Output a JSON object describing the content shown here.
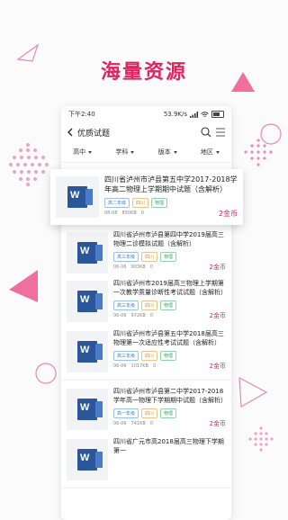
{
  "headline": "海量资源",
  "status": {
    "time": "下午2:40",
    "speed": "53.9K/s"
  },
  "nav": {
    "title": "优质试题"
  },
  "filters": [
    "高中",
    "学科",
    "版本",
    "地区"
  ],
  "featured": {
    "title": "四川省泸州市泸县第五中学2017-2018学年高二物理上学期期中试题（含解析）",
    "tags": [
      "高二年级",
      "四川",
      "物理"
    ],
    "date": "08-08",
    "size": "850KB",
    "downloads": "0",
    "price": "2金币"
  },
  "items": [
    {
      "title": "四川省泸州市泸县第四中学2019届高三物理二诊模拟试题（含解析）",
      "tags": [
        "高三年级",
        "四川",
        "物理"
      ],
      "date": "06-06",
      "size": "903KB",
      "downloads": "0",
      "price": "2金币"
    },
    {
      "title": "四川省泸州市2019届高三物理上学期第一次教学质量诊断性考试试题（含解析）",
      "tags": [
        "高三年级",
        "四川",
        "物理"
      ],
      "date": "06-06",
      "size": "972KB",
      "downloads": "0",
      "price": "2金币"
    },
    {
      "title": "四川省泸州市泸县第五中学2018届高三物理第一次适应性考试试题（含解析）",
      "tags": [
        "高三年级",
        "四川",
        "物理"
      ],
      "date": "06-06",
      "size": "1017KB",
      "downloads": "0",
      "price": "2金币"
    },
    {
      "title": "四川省泸州市泸县第二中学2017-2018学年高一物理下学期期中试题（含解析）",
      "tags": [
        "高一年级",
        "四川",
        "物理"
      ],
      "date": "06-06",
      "size": "741KB",
      "downloads": "0",
      "price": "2金币"
    },
    {
      "title": "四川省广元市高2018届高三物理下学期第一",
      "tags": [],
      "date": "",
      "size": "",
      "downloads": "",
      "price": ""
    }
  ],
  "colors": {
    "accent": "#e0245e",
    "word": "#2b579a"
  },
  "icons": [
    "back-icon",
    "search-icon",
    "menu-icon",
    "word-doc-icon",
    "calendar-icon",
    "file-size-icon",
    "download-icon"
  ]
}
